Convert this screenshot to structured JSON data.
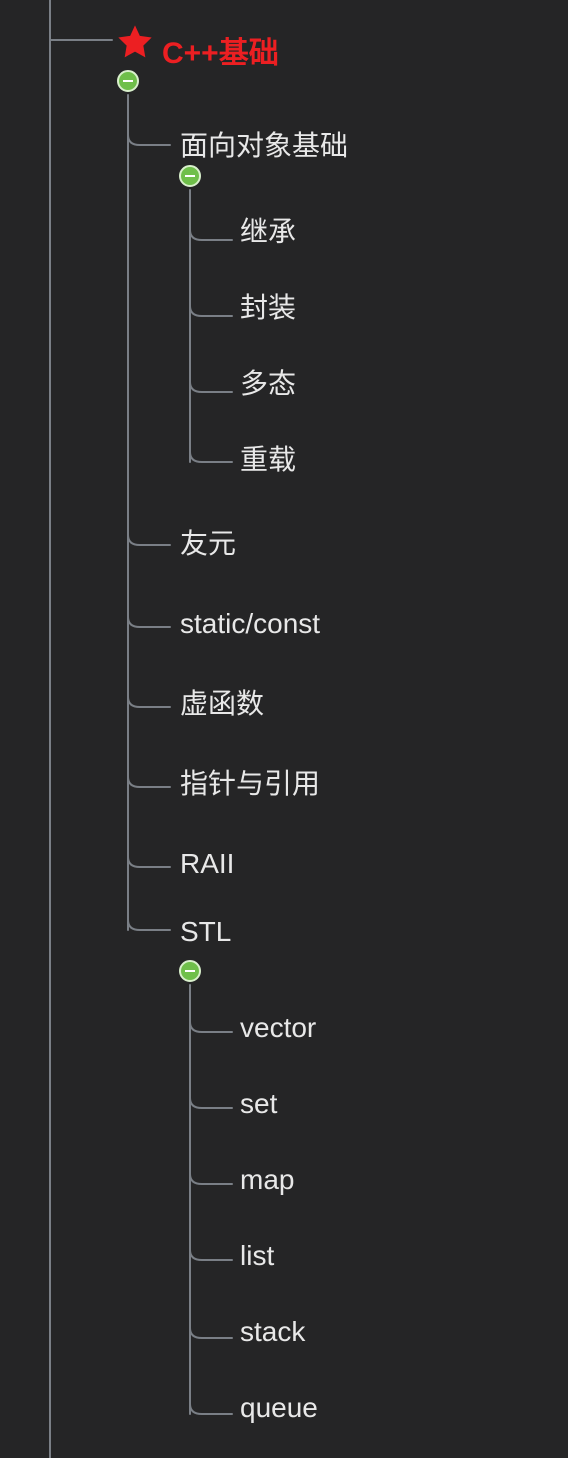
{
  "colors": {
    "background": "#252526",
    "line": "#7a7f86",
    "text": "#e8e8e8",
    "accent": "#ec1f22",
    "toggle_fill": "#6fbf4a",
    "toggle_ring": "#d9f0cc"
  },
  "icons": {
    "star": "star-icon",
    "collapse": "minus-circle-icon"
  },
  "tree": {
    "root": {
      "label": "C++基础",
      "starred": true,
      "expanded": true,
      "children": [
        {
          "id": "oop",
          "label": "面向对象基础",
          "expanded": true,
          "children": [
            {
              "id": "inherit",
              "label": "继承"
            },
            {
              "id": "encap",
              "label": "封装"
            },
            {
              "id": "poly",
              "label": "多态"
            },
            {
              "id": "overload",
              "label": "重载"
            }
          ]
        },
        {
          "id": "friend",
          "label": "友元"
        },
        {
          "id": "static_const",
          "label": "static/const"
        },
        {
          "id": "virtual",
          "label": "虚函数"
        },
        {
          "id": "ptr_ref",
          "label": "指针与引用"
        },
        {
          "id": "raii",
          "label": "RAII"
        },
        {
          "id": "stl",
          "label": "STL",
          "expanded": true,
          "children": [
            {
              "id": "vector",
              "label": "vector"
            },
            {
              "id": "set",
              "label": "set"
            },
            {
              "id": "map",
              "label": "map"
            },
            {
              "id": "list",
              "label": "list"
            },
            {
              "id": "stack",
              "label": "stack"
            },
            {
              "id": "queue",
              "label": "queue"
            }
          ]
        }
      ]
    }
  }
}
